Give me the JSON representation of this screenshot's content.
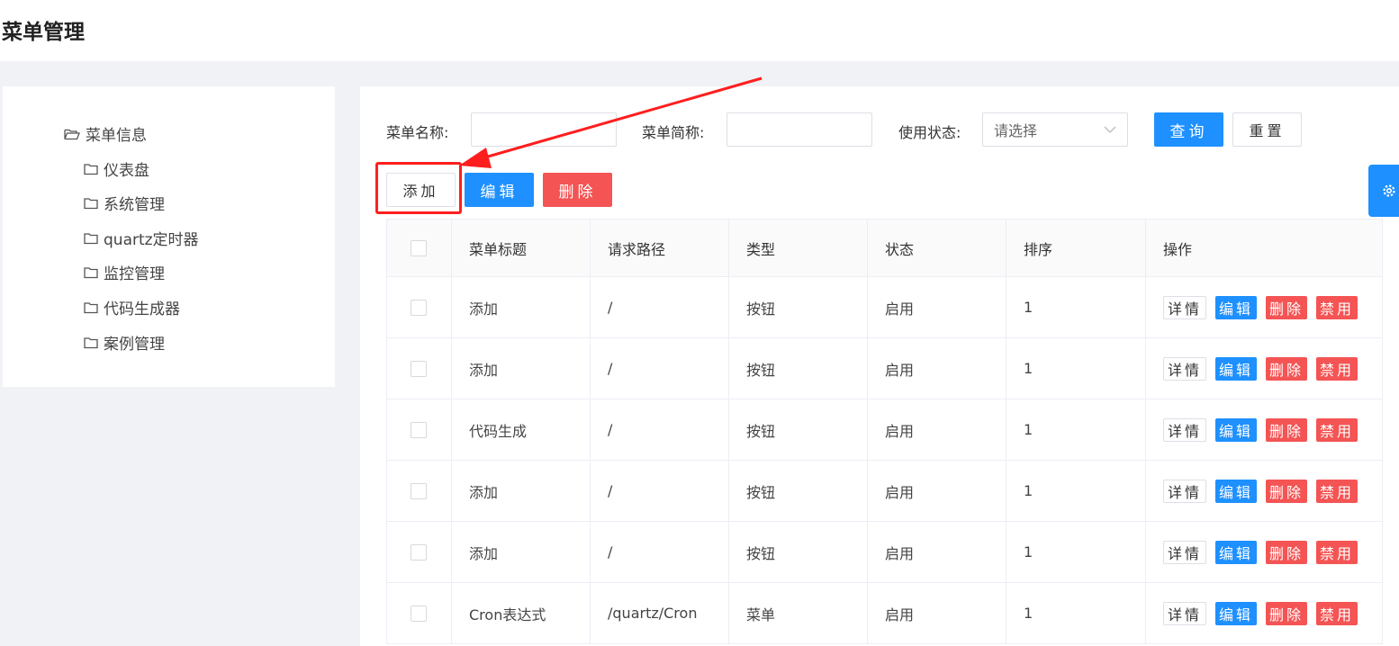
{
  "page": {
    "title": "菜单管理"
  },
  "tree": {
    "root": {
      "label": "菜单信息",
      "icon": "folder-open-icon"
    },
    "children": [
      {
        "label": "仪表盘",
        "icon": "folder-icon"
      },
      {
        "label": "系统管理",
        "icon": "folder-icon"
      },
      {
        "label": "quartz定时器",
        "icon": "folder-icon"
      },
      {
        "label": "监控管理",
        "icon": "folder-icon"
      },
      {
        "label": "代码生成器",
        "icon": "folder-icon"
      },
      {
        "label": "案例管理",
        "icon": "folder-icon"
      }
    ]
  },
  "search": {
    "menu_name_label": "菜单名称:",
    "menu_name_value": "",
    "short_name_label": "菜单简称:",
    "short_name_value": "",
    "status_label": "使用状态:",
    "status_placeholder": "请选择",
    "query_label": "查询",
    "reset_label": "重置"
  },
  "toolbar": {
    "add_label": "添加",
    "edit_label": "编辑",
    "delete_label": "删除"
  },
  "table": {
    "columns": [
      "菜单标题",
      "请求路径",
      "类型",
      "状态",
      "排序",
      "操作"
    ],
    "rows": [
      {
        "title": "添加",
        "path": "/",
        "type": "按钮",
        "status": "启用",
        "order": "1"
      },
      {
        "title": "添加",
        "path": "/",
        "type": "按钮",
        "status": "启用",
        "order": "1"
      },
      {
        "title": "代码生成",
        "path": "/",
        "type": "按钮",
        "status": "启用",
        "order": "1"
      },
      {
        "title": "添加",
        "path": "/",
        "type": "按钮",
        "status": "启用",
        "order": "1"
      },
      {
        "title": "添加",
        "path": "/",
        "type": "按钮",
        "status": "启用",
        "order": "1"
      },
      {
        "title": "Cron表达式",
        "path": "/quartz/Cron",
        "type": "菜单",
        "status": "启用",
        "order": "1"
      }
    ],
    "row_actions": {
      "detail": "详情",
      "edit": "编辑",
      "delete": "删除",
      "disable": "禁用"
    }
  },
  "colors": {
    "primary": "#1e90ff",
    "danger": "#f45454",
    "annotation": "#ff1e1e"
  },
  "settings_tab": {
    "icon": "gear-icon"
  }
}
